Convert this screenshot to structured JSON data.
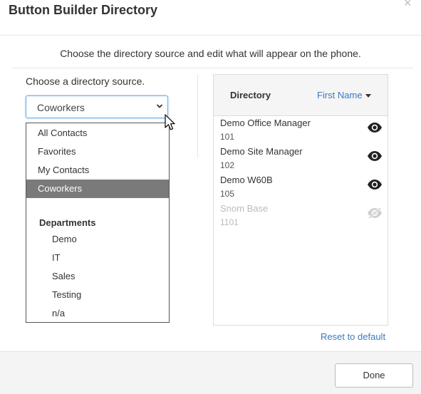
{
  "dialog": {
    "title": "Button Builder Directory",
    "close_glyph": "×",
    "subtitle": "Choose the directory source and edit what will appear on the phone."
  },
  "source": {
    "label": "Choose a directory source.",
    "selected": "Coworkers",
    "options": [
      "All Contacts",
      "Favorites",
      "My Contacts",
      "Coworkers"
    ],
    "group_label": "Departments",
    "departments": [
      "Demo",
      "IT",
      "Sales",
      "Testing",
      "n/a"
    ]
  },
  "directory": {
    "title": "Directory",
    "sort_label": "First Name",
    "entries": [
      {
        "name": "Demo Office Manager",
        "number": "101",
        "visible": true
      },
      {
        "name": "Demo Site Manager",
        "number": "102",
        "visible": true
      },
      {
        "name": "Demo W60B",
        "number": "105",
        "visible": true
      },
      {
        "name": "Snom Base",
        "number": "1101",
        "visible": false
      }
    ]
  },
  "actions": {
    "reset_label": "Reset to default",
    "done_label": "Done"
  },
  "colors": {
    "accent_link": "#3a7bc0",
    "selected_option_bg": "#7a7a7a",
    "focus_border": "#66afe9"
  },
  "icons": {
    "close": "close-icon",
    "select_chevron": "chevron-down-icon",
    "sort_caret": "caret-down-icon",
    "show": "eye-icon",
    "hidden": "eye-slash-icon",
    "cursor": "mouse-cursor-icon"
  }
}
